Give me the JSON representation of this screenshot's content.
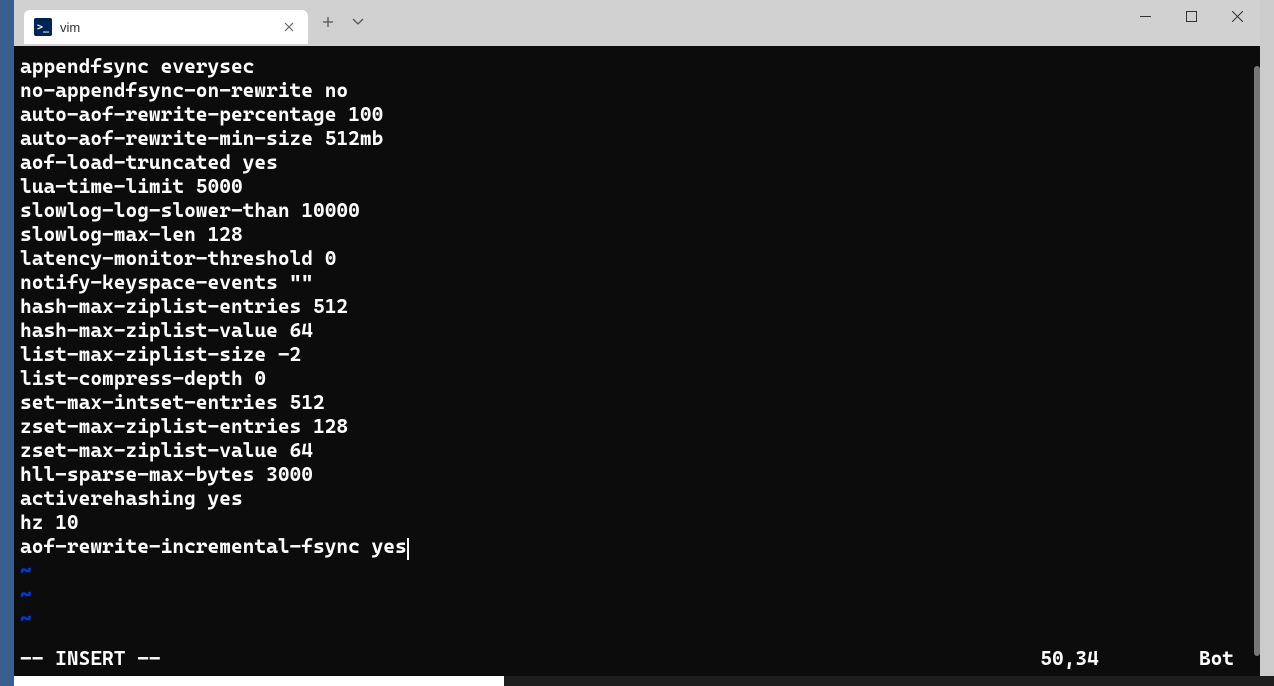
{
  "tab": {
    "title": "vim"
  },
  "editor": {
    "content_lines": [
      "appendfsync everysec",
      "no-appendfsync-on-rewrite no",
      "auto-aof-rewrite-percentage 100",
      "auto-aof-rewrite-min-size 512mb",
      "aof-load-truncated yes",
      "lua-time-limit 5000",
      "slowlog-log-slower-than 10000",
      "slowlog-max-len 128",
      "latency-monitor-threshold 0",
      "notify-keyspace-events \"\"",
      "hash-max-ziplist-entries 512",
      "hash-max-ziplist-value 64",
      "list-max-ziplist-size -2",
      "list-compress-depth 0",
      "set-max-intset-entries 512",
      "zset-max-ziplist-entries 128",
      "zset-max-ziplist-value 64",
      "hll-sparse-max-bytes 3000",
      "activerehashing yes",
      "hz 10",
      "aof-rewrite-incremental-fsync yes"
    ],
    "tilde_count": 3,
    "status": {
      "mode": "-- INSERT --",
      "position": "50,34",
      "percent": "Bot"
    }
  }
}
